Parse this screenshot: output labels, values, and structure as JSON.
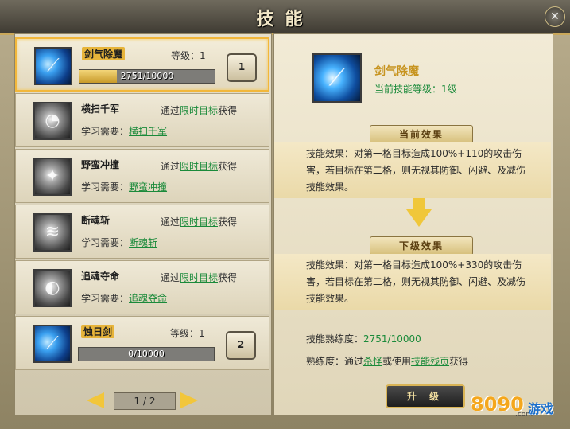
{
  "window": {
    "title": "技能",
    "close_icon": "x-icon"
  },
  "skills": [
    {
      "name": "剑气除魔",
      "level_label": "等级：1",
      "progress": {
        "current": 2751,
        "max": 10000,
        "text": "2751/10000"
      },
      "key": "1",
      "selected": true,
      "icon": "sword-slash-icon"
    },
    {
      "name": "横扫千军",
      "via_prefix": "通过",
      "via_link": "限时目标",
      "via_suffix": "获得",
      "req_label": "学习需要：",
      "req_link": "横扫千军",
      "icon": "sweep-icon"
    },
    {
      "name": "野蛮冲撞",
      "via_prefix": "通过",
      "via_link": "限时目标",
      "via_suffix": "获得",
      "req_label": "学习需要：",
      "req_link": "野蛮冲撞",
      "icon": "charge-icon"
    },
    {
      "name": "断魂斩",
      "via_prefix": "通过",
      "via_link": "限时目标",
      "via_suffix": "获得",
      "req_label": "学习需要：",
      "req_link": "断魂斩",
      "icon": "soul-slash-icon"
    },
    {
      "name": "追魂夺命",
      "via_prefix": "通过",
      "via_link": "限时目标",
      "via_suffix": "获得",
      "req_label": "学习需要：",
      "req_link": "追魂夺命",
      "icon": "chase-icon"
    },
    {
      "name": "蚀日剑",
      "level_label": "等级：1",
      "progress": {
        "current": 0,
        "max": 10000,
        "text": "0/10000"
      },
      "key": "2",
      "icon": "eclipse-sword-icon"
    }
  ],
  "pager": {
    "text": "1 / 2"
  },
  "detail": {
    "name": "剑气除魔",
    "current_level": "当前技能等级：1级",
    "current_banner": "当前效果",
    "current_effect": "技能效果：对第一格目标造成100%+110的攻击伤害，若目标在第二格，则无视其防御、闪避、及减伤技能效果。",
    "next_banner": "下级效果",
    "next_effect": "技能效果：对第一格目标造成100%+330的攻击伤害，若目标在第二格，则无视其防御、闪避、及减伤技能效果。",
    "proficiency_label": "技能熟练度：",
    "proficiency_value": "2751/10000",
    "source_prefix": "熟练度：通过",
    "source_link1": "杀怪",
    "source_mid": "或使用",
    "source_link2": "技能残页",
    "source_suffix": "获得",
    "upgrade_label": "升 级"
  },
  "watermark": {
    "num": "8090",
    "text": "游戏",
    "com": ".com"
  },
  "colors": {
    "accent_gold": "#f2b73a",
    "link_green": "#1a8a3a",
    "skill_name_gold": "#c79420"
  }
}
